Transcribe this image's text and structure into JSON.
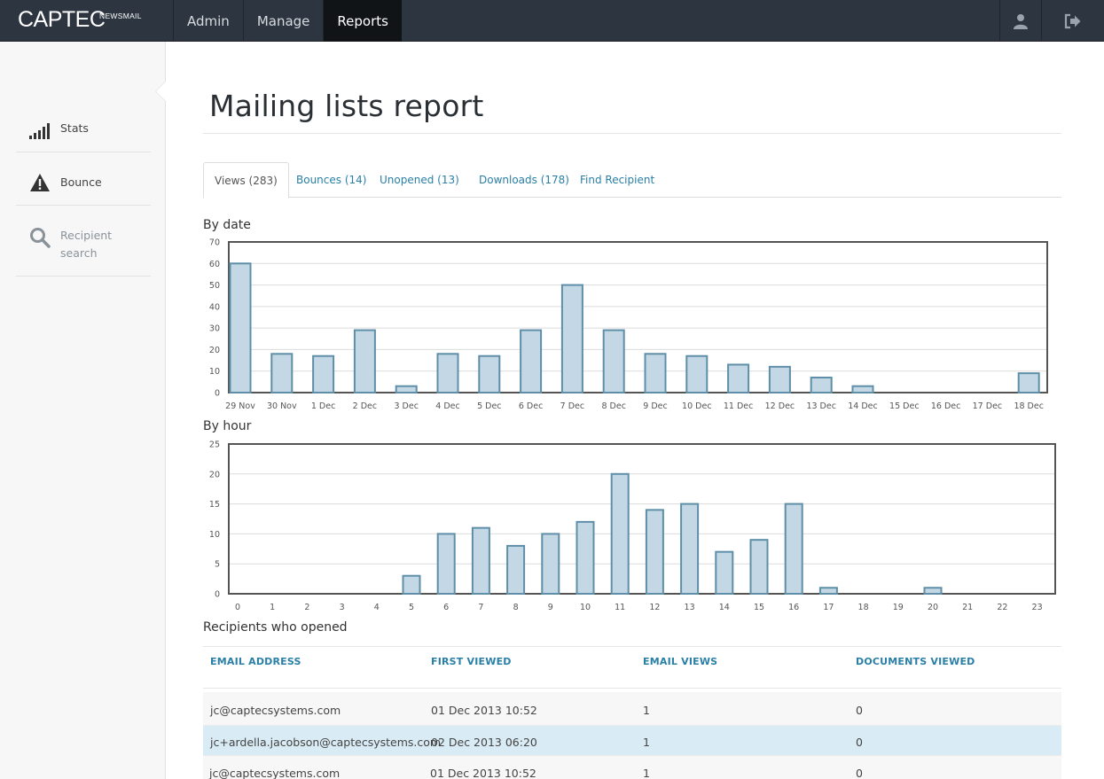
{
  "brand": {
    "name": "CAPTEC",
    "sup": "NEWSMAIL"
  },
  "nav": {
    "items": [
      "Admin",
      "Manage",
      "Reports"
    ],
    "active": "Reports",
    "icons": [
      "user-icon",
      "logout-icon"
    ]
  },
  "sidebar": {
    "items": [
      {
        "label": "Stats",
        "icon": "bar-signal-icon"
      },
      {
        "label": "Bounce",
        "icon": "warning-icon"
      },
      {
        "label_line1": "Recipient",
        "label_line2": "search",
        "icon": "search-icon"
      }
    ]
  },
  "page": {
    "title": "Mailing lists report"
  },
  "tabs": [
    "Views (283)",
    "Bounces (14)",
    "Unopened (13)",
    "Downloads (178)",
    "Find Recipient"
  ],
  "sections": {
    "by_date": "By date",
    "by_hour": "By hour",
    "recipients": "Recipients who opened"
  },
  "colors": {
    "bar_fill": "#c3d8e4",
    "bar_stroke": "#5f8fa8",
    "link": "#2a7fa6",
    "topbar": "#2d3640"
  },
  "chart_data": [
    {
      "type": "bar",
      "title": "By date",
      "categories": [
        "29 Nov",
        "30 Nov",
        "1 Dec",
        "2 Dec",
        "3 Dec",
        "4 Dec",
        "5 Dec",
        "6 Dec",
        "7 Dec",
        "8 Dec",
        "9 Dec",
        "10 Dec",
        "11 Dec",
        "12 Dec",
        "13 Dec",
        "14 Dec",
        "15 Dec",
        "16 Dec",
        "17 Dec",
        "18 Dec"
      ],
      "values": [
        60,
        18,
        17,
        29,
        3,
        18,
        17,
        29,
        50,
        29,
        18,
        17,
        13,
        12,
        7,
        3,
        0,
        0,
        0,
        9
      ],
      "ylim": [
        0,
        70
      ],
      "yticks": [
        0,
        10,
        20,
        30,
        40,
        50,
        60,
        70
      ],
      "grid": true
    },
    {
      "type": "bar",
      "title": "By hour",
      "categories": [
        "0",
        "1",
        "2",
        "3",
        "4",
        "5",
        "6",
        "7",
        "8",
        "9",
        "10",
        "11",
        "12",
        "13",
        "14",
        "15",
        "16",
        "17",
        "18",
        "19",
        "20",
        "21",
        "22",
        "23"
      ],
      "values": [
        0,
        0,
        0,
        0,
        0,
        3,
        10,
        11,
        8,
        10,
        12,
        20,
        14,
        15,
        7,
        9,
        15,
        1,
        0,
        0,
        1,
        0,
        0,
        0
      ],
      "ylim": [
        0,
        25
      ],
      "yticks": [
        0,
        5,
        10,
        15,
        20,
        25
      ],
      "grid": true
    }
  ],
  "table": {
    "headers": [
      "EMAIL ADDRESS",
      "FIRST VIEWED",
      "EMAIL VIEWS",
      "DOCUMENTS VIEWED"
    ],
    "rows": [
      [
        "jc@captecsystems.com",
        "01 Dec 2013 10:52",
        "1",
        "0"
      ],
      [
        "jc+ardella.jacobson@captecsystems.com",
        "02 Dec 2013 06:20",
        "1",
        "0"
      ],
      [
        "jc@captecsystems.com",
        "01 Dec 2013 10:52",
        "1",
        "0"
      ]
    ]
  }
}
